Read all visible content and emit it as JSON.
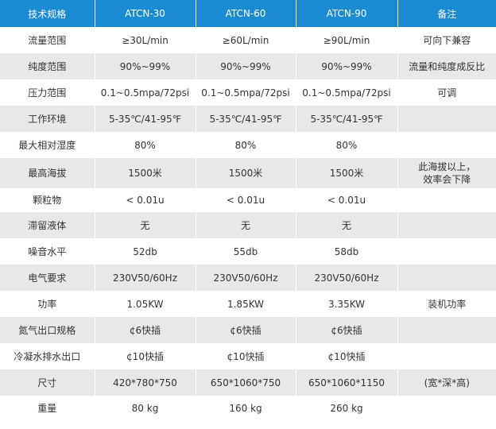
{
  "table": {
    "headers": [
      "技术规格",
      "ATCN-30",
      "ATCN-60",
      "ATCN-90",
      "备注"
    ],
    "rows": [
      {
        "spec": "流量范围",
        "v30": "≥30L/min",
        "v60": "≥60L/min",
        "v90": "≥90L/min",
        "note": "可向下兼容"
      },
      {
        "spec": "纯度范围",
        "v30": "90%~99%",
        "v60": "90%~99%",
        "v90": "90%~99%",
        "note": "流量和纯度成反比"
      },
      {
        "spec": "压力范围",
        "v30": "0.1~0.5mpa/72psi",
        "v60": "0.1~0.5mpa/72psi",
        "v90": "0.1~0.5mpa/72psi",
        "note": "可调"
      },
      {
        "spec": "工作环境",
        "v30": "5-35℃/41-95℉",
        "v60": "5-35℃/41-95℉",
        "v90": "5-35℃/41-95℉",
        "note": ""
      },
      {
        "spec": "最大相对湿度",
        "v30": "80%",
        "v60": "80%",
        "v90": "80%",
        "note": ""
      },
      {
        "spec": "最高海拔",
        "v30": "1500米",
        "v60": "1500米",
        "v90": "1500米",
        "note_lines": [
          "此海拔以上，",
          "效率会下降"
        ]
      },
      {
        "spec": "颗粒物",
        "v30": "< 0.01u",
        "v60": "< 0.01u",
        "v90": "< 0.01u",
        "note": ""
      },
      {
        "spec": "滞留液体",
        "v30": "无",
        "v60": "无",
        "v90": "无",
        "note": ""
      },
      {
        "spec": "噪音水平",
        "v30": "52db",
        "v60": "55db",
        "v90": "58db",
        "note": ""
      },
      {
        "spec": "电气要求",
        "v30": "230V50/60Hz",
        "v60": "230V50/60Hz",
        "v90": "230V50/60Hz",
        "note": ""
      },
      {
        "spec": "功率",
        "v30": "1.05KW",
        "v60": "1.85KW",
        "v90": "3.35KW",
        "note": "装机功率"
      },
      {
        "spec": "氮气出口规格",
        "v30": "¢6快插",
        "v60": "¢6快插",
        "v90": "¢6快插",
        "note": ""
      },
      {
        "spec": "冷凝水排水出口",
        "v30": "¢10快插",
        "v60": "¢10快插",
        "v90": "¢10快插",
        "note": ""
      },
      {
        "spec": "尺寸",
        "v30": "420*780*750",
        "v60": "650*1060*750",
        "v90": "650*1060*1150",
        "note": "(宽*深*高)"
      },
      {
        "spec": "重量",
        "v30": "80 kg",
        "v60": "160 kg",
        "v90": "260 kg",
        "note": ""
      }
    ]
  },
  "colors": {
    "header_bg": "#1a8ad2",
    "header_text": "#ffffff",
    "stripe": "#e8e8e8",
    "text": "#333333"
  }
}
